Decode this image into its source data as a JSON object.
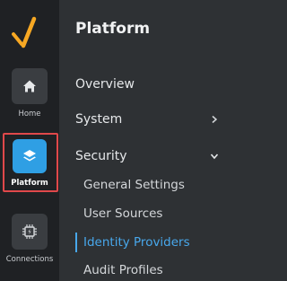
{
  "rail": {
    "items": [
      {
        "label": "Home",
        "icon": "home-icon"
      },
      {
        "label": "Platform",
        "icon": "layers-icon"
      },
      {
        "label": "Connections",
        "icon": "chip-icon"
      }
    ]
  },
  "panel": {
    "title": "Platform",
    "items": [
      {
        "label": "Overview"
      },
      {
        "label": "System",
        "icon": "chevron-right-icon"
      },
      {
        "label": "Security",
        "icon": "chevron-down-icon"
      }
    ],
    "security_children": [
      {
        "label": "General Settings"
      },
      {
        "label": "User Sources"
      },
      {
        "label": "Identity Providers"
      },
      {
        "label": "Audit Profiles"
      }
    ]
  },
  "colors": {
    "accent": "#2f9fe4",
    "active_link": "#48a8ec",
    "highlight_border": "#e0484a",
    "logo": "#f7a823"
  }
}
